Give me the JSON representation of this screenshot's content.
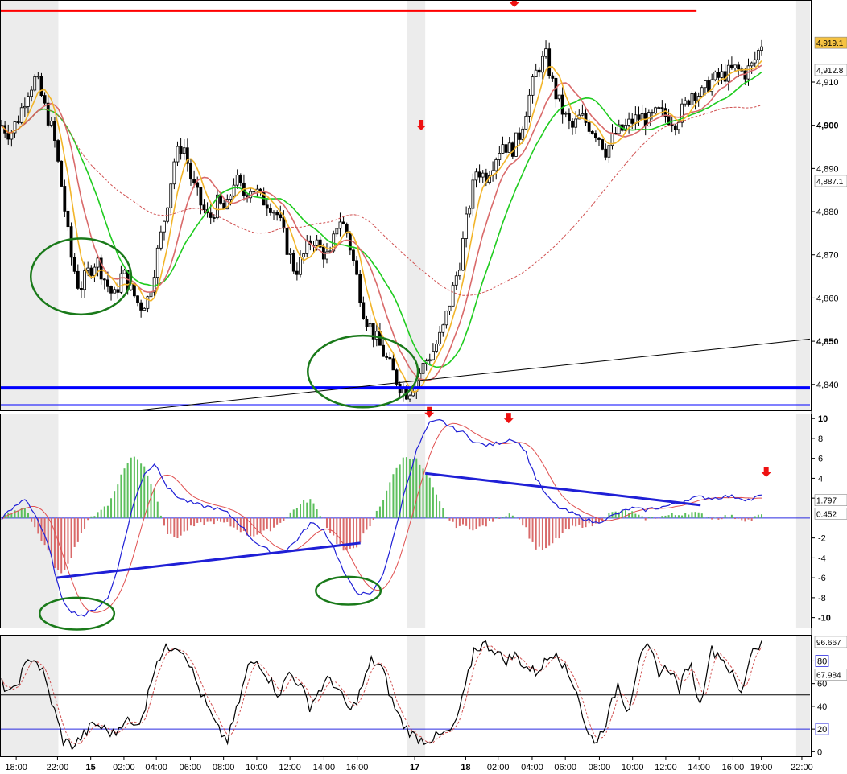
{
  "chart_data": [
    {
      "type": "candlestick",
      "panel": "price",
      "ylim": [
        4834,
        4929
      ],
      "yticks": [
        "4,910",
        "4,900",
        "4,890",
        "4,880",
        "4,870",
        "4,860",
        "4,850",
        "4,840"
      ],
      "bold_ticks": [
        "4,900",
        "4,850"
      ],
      "last_labels": [
        {
          "text": "4,919.1",
          "value": 4919.1,
          "bg": "#f5c242",
          "fg": "#000000"
        },
        {
          "text": "4,912.8",
          "value": 4912.8,
          "bg": "#ffffff",
          "fg": "#2fc42f"
        },
        {
          "text": "4,887.1",
          "value": 4887.1,
          "bg": "#ffffff",
          "fg": "#d05050"
        }
      ],
      "horizontal_lines": [
        {
          "value": 4926.5,
          "color": "#ff0000",
          "x_end_frac": 0.86
        },
        {
          "value": 4839.2,
          "color": "#0000ff",
          "thick": true
        },
        {
          "value": 4835.3,
          "color": "#0000ff",
          "thick": false
        }
      ],
      "trendline": {
        "x_start_frac": 0.17,
        "x_end_frac": 1.0,
        "y_start": 4834.0,
        "y_end": 4850.5,
        "color": "#000000"
      },
      "path": [
        4900,
        4898,
        4902,
        4908,
        4911,
        4904,
        4898,
        4885,
        4870,
        4862,
        4866,
        4869,
        4864,
        4860,
        4866,
        4862,
        4858,
        4860,
        4870,
        4880,
        4892,
        4896,
        4887,
        4882,
        4878,
        4882,
        4880,
        4888,
        4884,
        4886,
        4883,
        4882,
        4879,
        4872,
        4866,
        4870,
        4874,
        4871,
        4869,
        4879,
        4875,
        4866,
        4856,
        4852,
        4848,
        4844,
        4840,
        4838,
        4841,
        4845,
        4848,
        4852,
        4860,
        4868,
        4880,
        4890,
        4888,
        4892,
        4896,
        4894,
        4898,
        4906,
        4913,
        4916,
        4908,
        4903,
        4899,
        4902,
        4900,
        4898,
        4894,
        4898,
        4899,
        4901,
        4902,
        4901,
        4903,
        4902,
        4901,
        4904,
        4908,
        4907,
        4910,
        4911,
        4912,
        4913,
        4912,
        4914,
        4919
      ],
      "series": [
        {
          "name": "",
          "color": "#1fcc1f",
          "window": 20
        },
        {
          "name": "",
          "color": "#d96a6a",
          "window": 12
        },
        {
          "name": "",
          "color": "#f2b52a",
          "window": 6
        },
        {
          "name": "",
          "color": "#d05050",
          "dashed": true,
          "window": 60
        }
      ],
      "markers": [
        {
          "type": "down-arrow",
          "x_frac": 0.52,
          "y": 4899
        },
        {
          "type": "down-arrow",
          "x_frac": 0.635,
          "y": 4927.5
        },
        {
          "type": "down-arrow",
          "x_frac": 0.965,
          "y": 4929
        }
      ],
      "ellipses": [
        {
          "x_frac": 0.1,
          "y": 4865,
          "rx_frac": 0.062,
          "ry": 8.8
        },
        {
          "x_frac": 0.448,
          "y": 4843,
          "rx_frac": 0.068,
          "ry": 8.3
        }
      ]
    },
    {
      "type": "macd",
      "panel": "oscillator",
      "ylim": [
        -11,
        10.5
      ],
      "yticks": [
        "10",
        "8",
        "6",
        "4",
        "2",
        "-2",
        "-4",
        "-6",
        "-8",
        "-10"
      ],
      "bold_ticks": [
        "10",
        "-10"
      ],
      "zero_line": true,
      "last_labels": [
        {
          "text": "1.797",
          "value": 1.797,
          "fg": "#d05050"
        },
        {
          "text": "0.452",
          "value": 0.452,
          "fg": "#2fc42f"
        }
      ],
      "line_path": [
        0,
        1,
        2,
        0,
        -3,
        -8,
        -9.5,
        -9.8,
        -9,
        -8,
        -4,
        1,
        4.5,
        5.5,
        3,
        2,
        1.5,
        1.2,
        1,
        0.5,
        -0.5,
        -2,
        -3,
        -3.5,
        -3.2,
        -2,
        -0.5,
        -1,
        -3,
        -6,
        -7.5,
        -7.8,
        -6,
        -2,
        3,
        7,
        9.5,
        9.8,
        9,
        8.5,
        7.5,
        7.3,
        7.6,
        8,
        7,
        4,
        2,
        1,
        0.5,
        0,
        -0.5,
        0,
        0.5,
        1,
        0.8,
        1,
        1.2,
        1.5,
        2,
        2.1,
        2,
        2.2,
        2.1,
        1.8,
        2.3
      ],
      "series": [
        {
          "name": "",
          "color": "#1f1fd6"
        },
        {
          "name": "",
          "color": "#e05050"
        }
      ],
      "histogram_colors": {
        "positive": "#5cbf5c",
        "negative": "#d96a6a"
      },
      "trendlines": [
        {
          "x1_frac": 0.07,
          "y1": -6,
          "x2_frac": 0.445,
          "y2": -2.5
        },
        {
          "x1_frac": 0.525,
          "y1": 4.5,
          "x2_frac": 0.865,
          "y2": 1.3
        }
      ],
      "markers": [
        {
          "type": "down-arrow",
          "x_frac": 0.53,
          "y": 10.2
        },
        {
          "type": "down-arrow",
          "x_frac": 0.628,
          "y": 9.6
        },
        {
          "type": "down-arrow",
          "x_frac": 0.946,
          "y": 4.2
        }
      ],
      "ellipses": [
        {
          "x_frac": 0.095,
          "y": -9.6,
          "rx_frac": 0.046,
          "ry": 1.6
        },
        {
          "x_frac": 0.43,
          "y": -7.3,
          "rx_frac": 0.04,
          "ry": 1.4
        }
      ]
    },
    {
      "type": "stochastic",
      "panel": "stochastic",
      "ylim": [
        -4,
        103
      ],
      "yticks": [
        "80",
        "60",
        "40",
        "20",
        "0"
      ],
      "boxed_ticks": [
        "80",
        "20"
      ],
      "reference_lines": [
        {
          "value": 80,
          "color": "#2a2ae0"
        },
        {
          "value": 50,
          "color": "#000000"
        },
        {
          "value": 20,
          "color": "#2a2ae0"
        }
      ],
      "last_labels": [
        {
          "text": "96.667",
          "value": 96.667,
          "fg": "#000000"
        },
        {
          "text": "67.984",
          "value": 67.984,
          "fg": "#d05050"
        }
      ],
      "line_path": [
        60,
        50,
        70,
        85,
        70,
        40,
        10,
        5,
        15,
        25,
        20,
        15,
        30,
        20,
        40,
        80,
        90,
        95,
        85,
        60,
        40,
        20,
        10,
        40,
        75,
        80,
        65,
        50,
        70,
        60,
        40,
        55,
        65,
        50,
        35,
        55,
        80,
        75,
        45,
        25,
        15,
        10,
        12,
        15,
        20,
        50,
        90,
        95,
        90,
        80,
        85,
        75,
        70,
        80,
        90,
        70,
        55,
        15,
        10,
        30,
        60,
        35,
        80,
        92,
        70,
        75,
        55,
        80,
        40,
        90,
        85,
        70,
        50,
        90,
        96
      ],
      "series": [
        {
          "name": "",
          "color": "#000000"
        },
        {
          "name": "",
          "color": "#d05050",
          "dashed": true
        }
      ],
      "x_axis": {
        "ticks": [
          {
            "label": "18:00",
            "frac": 0.02
          },
          {
            "label": "22:00",
            "frac": 0.071
          },
          {
            "label": "15",
            "frac": 0.112,
            "bold": true
          },
          {
            "label": "02:00",
            "frac": 0.153
          },
          {
            "label": "04:00",
            "frac": 0.193
          },
          {
            "label": "06:00",
            "frac": 0.235
          },
          {
            "label": "08:00",
            "frac": 0.276
          },
          {
            "label": "10:00",
            "frac": 0.317
          },
          {
            "label": "12:00",
            "frac": 0.358
          },
          {
            "label": "14:00",
            "frac": 0.4
          },
          {
            "label": "16:00",
            "frac": 0.441
          },
          {
            "label": "17",
            "frac": 0.512,
            "bold": true
          },
          {
            "label": "18",
            "frac": 0.575,
            "bold": true
          },
          {
            "label": "02:00",
            "frac": 0.615
          },
          {
            "label": "04:00",
            "frac": 0.657
          },
          {
            "label": "06:00",
            "frac": 0.698
          },
          {
            "label": "08:00",
            "frac": 0.74
          },
          {
            "label": "10:00",
            "frac": 0.781
          },
          {
            "label": "12:00",
            "frac": 0.822
          },
          {
            "label": "14:00",
            "frac": 0.863
          },
          {
            "label": "16:00",
            "frac": 0.905
          },
          {
            "label": "19:00",
            "frac": 0.94
          },
          {
            "label": "22:00",
            "frac": 0.99
          }
        ],
        "session_bands": [
          {
            "start_frac": 0.0,
            "end_frac": 0.072
          },
          {
            "start_frac": 0.502,
            "end_frac": 0.525
          },
          {
            "start_frac": 0.983,
            "end_frac": 1.0
          }
        ]
      }
    }
  ]
}
